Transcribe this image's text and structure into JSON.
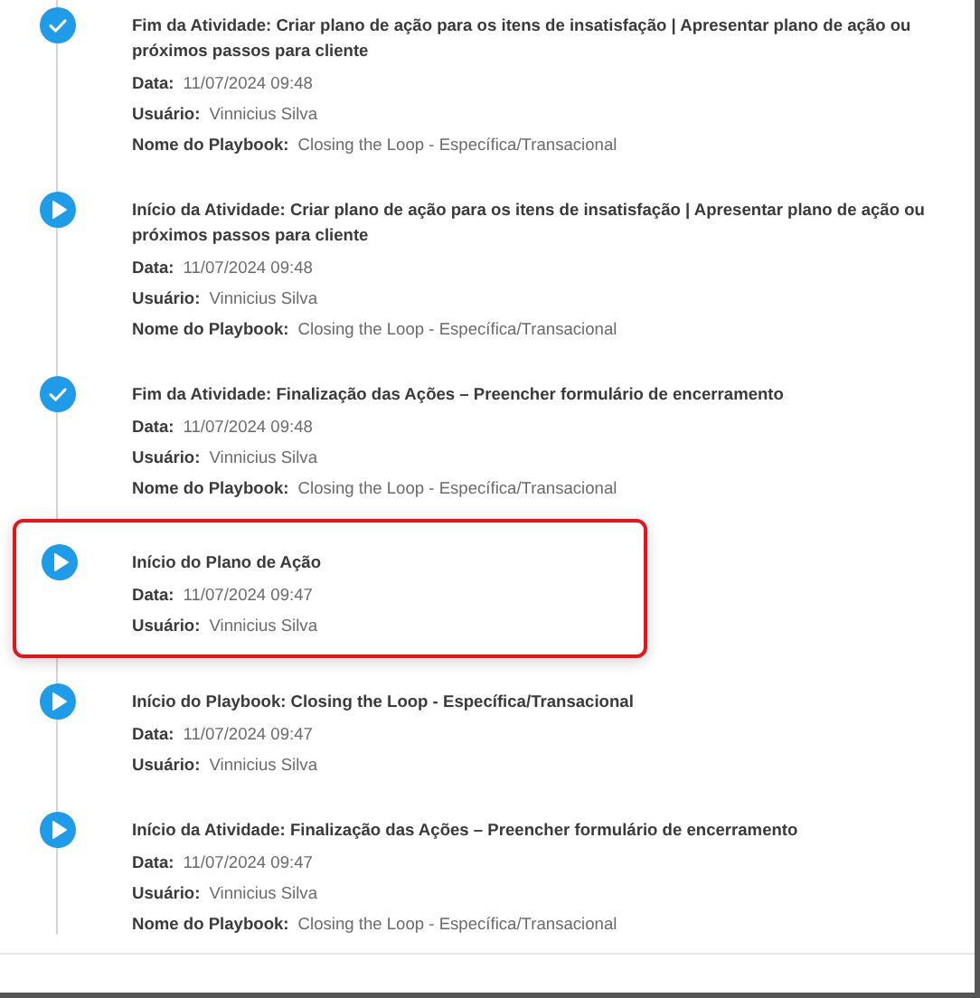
{
  "timeline": [
    {
      "kind": "end",
      "highlighted": false,
      "title": "Fim da Atividade: Criar plano de ação para os itens de insatisfação | Apresentar plano de ação ou próximos passos para cliente",
      "fields": [
        {
          "label": "Data:",
          "value": "11/07/2024 09:48"
        },
        {
          "label": "Usuário:",
          "value": "Vinnicius Silva"
        },
        {
          "label": "Nome do Playbook:",
          "value": "Closing the Loop - Específica/Transacional"
        }
      ]
    },
    {
      "kind": "start",
      "highlighted": false,
      "title": "Início da Atividade: Criar plano de ação para os itens de insatisfação | Apresentar plano de ação ou próximos passos para cliente",
      "fields": [
        {
          "label": "Data:",
          "value": "11/07/2024 09:48"
        },
        {
          "label": "Usuário:",
          "value": "Vinnicius Silva"
        },
        {
          "label": "Nome do Playbook:",
          "value": "Closing the Loop - Específica/Transacional"
        }
      ]
    },
    {
      "kind": "end",
      "highlighted": false,
      "title": "Fim da Atividade: Finalização das Ações – Preencher formulário de encerramento",
      "fields": [
        {
          "label": "Data:",
          "value": "11/07/2024 09:48"
        },
        {
          "label": "Usuário:",
          "value": "Vinnicius Silva"
        },
        {
          "label": "Nome do Playbook:",
          "value": "Closing the Loop - Específica/Transacional"
        }
      ]
    },
    {
      "kind": "start",
      "highlighted": true,
      "title": "Início do Plano de Ação",
      "fields": [
        {
          "label": "Data:",
          "value": "11/07/2024 09:47"
        },
        {
          "label": "Usuário:",
          "value": "Vinnicius Silva"
        }
      ]
    },
    {
      "kind": "start",
      "highlighted": false,
      "title": "Início do Playbook: Closing the Loop - Específica/Transacional",
      "fields": [
        {
          "label": "Data:",
          "value": "11/07/2024 09:47"
        },
        {
          "label": "Usuário:",
          "value": "Vinnicius Silva"
        }
      ]
    },
    {
      "kind": "start",
      "highlighted": false,
      "title": "Início da Atividade: Finalização das Ações – Preencher formulário de encerramento",
      "fields": [
        {
          "label": "Data:",
          "value": "11/07/2024 09:47"
        },
        {
          "label": "Usuário:",
          "value": "Vinnicius Silva"
        },
        {
          "label": "Nome do Playbook:",
          "value": "Closing the Loop - Específica/Transacional"
        }
      ]
    }
  ]
}
